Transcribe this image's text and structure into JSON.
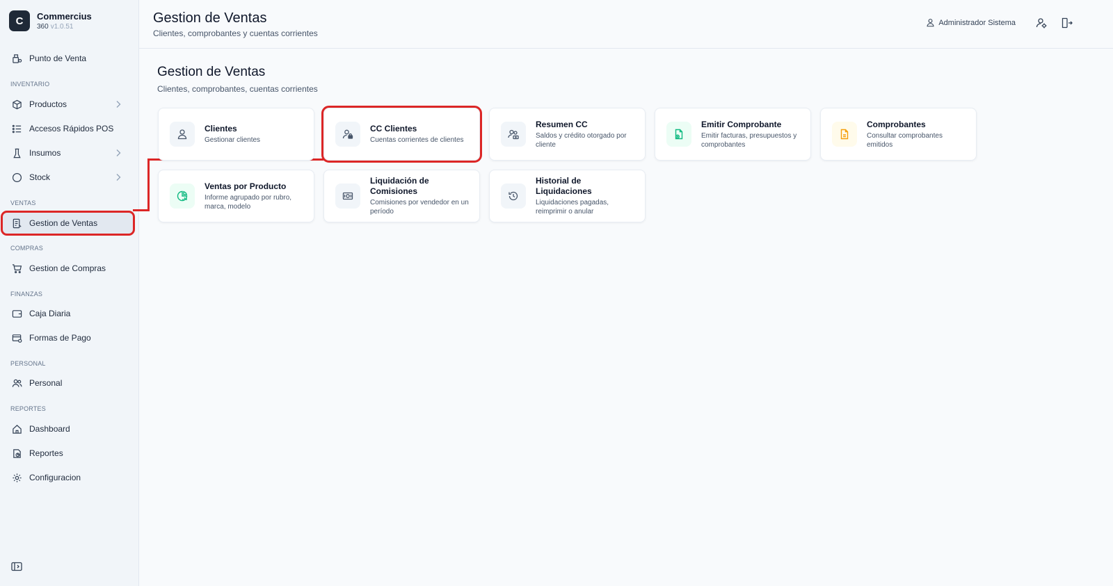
{
  "brand": {
    "logo_letter": "C",
    "name": "Commercius",
    "sub": "360",
    "version": "v1.0.51"
  },
  "sidebar": {
    "sections": {
      "inventario": "INVENTARIO",
      "ventas": "VENTAS",
      "compras": "COMPRAS",
      "finanzas": "FINANZAS",
      "personal": "PERSONAL",
      "reportes": "REPORTES"
    },
    "items": {
      "punto_venta": "Punto de Venta",
      "productos": "Productos",
      "accesos": "Accesos Rápidos POS",
      "insumos": "Insumos",
      "stock": "Stock",
      "gestion_ventas": "Gestion de Ventas",
      "gestion_compras": "Gestion de Compras",
      "caja": "Caja Diaria",
      "formas_pago": "Formas de Pago",
      "personal": "Personal",
      "dashboard": "Dashboard",
      "reportes": "Reportes",
      "configuracion": "Configuracion"
    },
    "active_item": "gestion_ventas"
  },
  "header": {
    "title": "Gestion de Ventas",
    "subtitle": "Clientes, comprobantes y cuentas corrientes",
    "user": "Administrador Sistema"
  },
  "main": {
    "title": "Gestion de Ventas",
    "subtitle": "Clientes, comprobantes, cuentas corrientes",
    "cards": [
      {
        "title": "Clientes",
        "desc": "Gestionar clientes"
      },
      {
        "title": "CC Clientes",
        "desc": "Cuentas corrientes de clientes"
      },
      {
        "title": "Resumen CC",
        "desc": "Saldos y crédito otorgado por cliente"
      },
      {
        "title": "Emitir Comprobante",
        "desc": "Emitir facturas, presupuestos y comprobantes"
      },
      {
        "title": "Comprobantes",
        "desc": "Consultar comprobantes emitidos"
      },
      {
        "title": "Ventas por Producto",
        "desc": "Informe agrupado por rubro, marca, modelo"
      },
      {
        "title": "Liquidación de Comisiones",
        "desc": "Comisiones por vendedor en un período"
      },
      {
        "title": "Historial de Liquidaciones",
        "desc": "Liquidaciones pagadas, reimprimir o anular"
      }
    ]
  },
  "colors": {
    "highlight": "#dc2626",
    "accent_green": "#10b981",
    "accent_amber": "#f59e0b"
  }
}
